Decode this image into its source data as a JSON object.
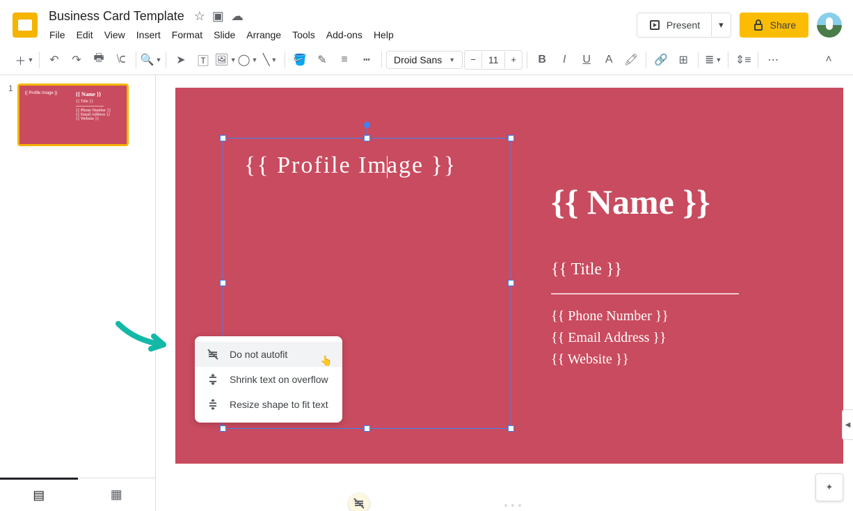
{
  "doc": {
    "title": "Business Card Template"
  },
  "menus": {
    "file": "File",
    "edit": "Edit",
    "view": "View",
    "insert": "Insert",
    "format": "Format",
    "slide": "Slide",
    "arrange": "Arrange",
    "tools": "Tools",
    "addons": "Add-ons",
    "help": "Help"
  },
  "header_buttons": {
    "present": "Present",
    "share": "Share"
  },
  "toolbar": {
    "font": "Droid Sans",
    "font_size": "11"
  },
  "thumbnail": {
    "number": "1"
  },
  "slide": {
    "profile_pre": "{{ Profile Im",
    "profile_post": "age }}",
    "name": "{{ Name }}",
    "title": "{{ Title }}",
    "phone": "{{ Phone Number }}",
    "email": "{{ Email Address }}",
    "website": "{{ Website }}"
  },
  "thumb": {
    "profile": "{{ Profile Image }}",
    "name": "{{ Name }}",
    "title": "{{ Title }}",
    "phone": "{{ Phone Number }}",
    "email": "{{ Email Address }}",
    "website": "{{ Website }}"
  },
  "autofit_menu": {
    "opt1": "Do not autofit",
    "opt2": "Shrink text on overflow",
    "opt3": "Resize shape to fit text"
  },
  "colors": {
    "slide_bg": "#c94b5f",
    "accent": "#f4b400"
  }
}
